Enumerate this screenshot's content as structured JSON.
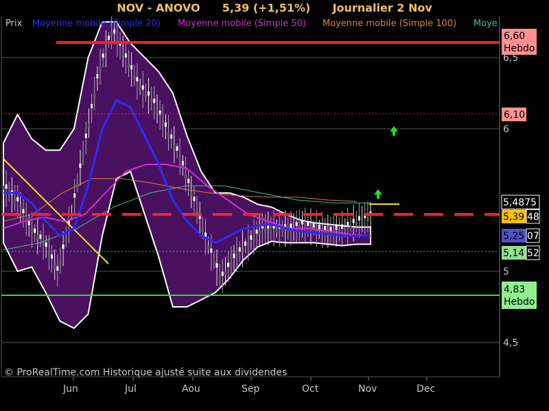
{
  "header": {
    "title": "NOV - ANOVO",
    "quote": "5,39 (+1,51%)",
    "period": "Journalier  2 Nov"
  },
  "legend": [
    {
      "label": "Prix",
      "color": "#c8c8c8"
    },
    {
      "label": "Moyenne mobile (Simple 20)",
      "color": "#2a2aff"
    },
    {
      "label": "Moyenne mobile (Simple 50)",
      "color": "#d030d0"
    },
    {
      "label": "Moyenne mobile (Simple 100)",
      "color": "#e08030"
    },
    {
      "label": "Moye",
      "color": "#40c0a0"
    }
  ],
  "footer": "© ProRealTime.com Historique ajusté suite aux dividendes",
  "colors": {
    "background": "#000000",
    "band_fill": "#4a1060",
    "band_edge": "#ffffff",
    "resistance": "#ff2020",
    "support": "#30e030",
    "ma20": "#2a2aff",
    "ma50": "#d030d0",
    "ma100": "#e08030",
    "ma200": "#40c0a0",
    "trendline": "#ffe020"
  },
  "chart_data": {
    "type": "line",
    "ylim": [
      4.3,
      6.75
    ],
    "y_ticks": [
      "4,5",
      "5",
      "6",
      "6,5"
    ],
    "y_tick_values": [
      4.5,
      5.0,
      6.0,
      6.5
    ],
    "x_ticks": [
      "Jun",
      "Jul",
      "Aou",
      "Sep",
      "Oct",
      "Nov",
      "Dec"
    ],
    "price_tags": [
      {
        "label": "6,60",
        "sub": "Hebdo",
        "value": 6.6,
        "bg": "#ff9090",
        "fg": "#000000"
      },
      {
        "label": "6,10",
        "sub": "",
        "value": 6.1,
        "bg": "#ff9090",
        "fg": "#000000"
      },
      {
        "label": "5,4875",
        "sub": "",
        "value": 5.4875,
        "bg": "#000000",
        "fg": "#ffffff"
      },
      {
        "label": "5,39",
        "sub": "48",
        "value": 5.3948,
        "bg": "#ffc000",
        "fg": "#000000"
      },
      {
        "label": "5,25",
        "sub": "07",
        "value": 5.2507,
        "bg": "#5050d0",
        "fg": "#000000"
      },
      {
        "label": "5,14",
        "sub": "52",
        "value": 5.1452,
        "bg": "#90e090",
        "fg": "#000000"
      },
      {
        "label": "4,83",
        "sub": "Hebdo",
        "value": 4.83,
        "bg": "#90f090",
        "fg": "#000000"
      }
    ],
    "horizontal_lines": [
      {
        "name": "resistance-hebdo",
        "value": 6.6,
        "style": "solid"
      },
      {
        "name": "resistance-daily",
        "value": 6.1,
        "style": "dotted"
      },
      {
        "name": "pivot-dashed",
        "value": 5.4,
        "style": "dashed"
      },
      {
        "name": "support-dotted",
        "value": 5.145,
        "style": "dotted"
      },
      {
        "name": "support-hebdo",
        "value": 4.83,
        "style": "solid"
      }
    ],
    "series": [
      {
        "name": "Prix",
        "values": [
          5.6,
          5.5,
          5.3,
          5.2,
          5.0,
          5.4,
          5.9,
          6.4,
          6.7,
          6.5,
          6.3,
          6.2,
          6.0,
          5.8,
          5.5,
          5.2,
          4.95,
          5.1,
          5.2,
          5.3,
          5.3,
          5.3,
          5.33,
          5.3,
          5.28,
          5.3,
          5.35,
          5.39
        ]
      },
      {
        "name": "Moyenne mobile (Simple 20)",
        "values": [
          5.55,
          5.55,
          5.48,
          5.35,
          5.25,
          5.3,
          5.6,
          6.0,
          6.2,
          6.15,
          5.95,
          5.75,
          5.5,
          5.35,
          5.25,
          5.2,
          5.25,
          5.3,
          5.32,
          5.33,
          5.3,
          5.28,
          5.27,
          5.26,
          5.25,
          5.25,
          5.25
        ]
      },
      {
        "name": "Moyenne mobile (Simple 50)",
        "values": [
          5.3,
          5.35,
          5.38,
          5.35,
          5.4,
          5.55,
          5.7,
          5.75,
          5.75,
          5.72,
          5.6,
          5.5,
          5.4,
          5.35,
          5.3,
          5.3,
          5.28,
          5.26,
          5.25
        ]
      },
      {
        "name": "Moyenne mobile (Simple 100)",
        "values": [
          5.35,
          5.4,
          5.55,
          5.65,
          5.65,
          5.62,
          5.58,
          5.55,
          5.53,
          5.52,
          5.52,
          5.5,
          5.49
        ]
      },
      {
        "name": "Moye",
        "values": [
          5.15,
          5.2,
          5.3,
          5.45,
          5.55,
          5.6,
          5.6,
          5.55,
          5.5,
          5.48,
          5.48
        ]
      }
    ]
  }
}
